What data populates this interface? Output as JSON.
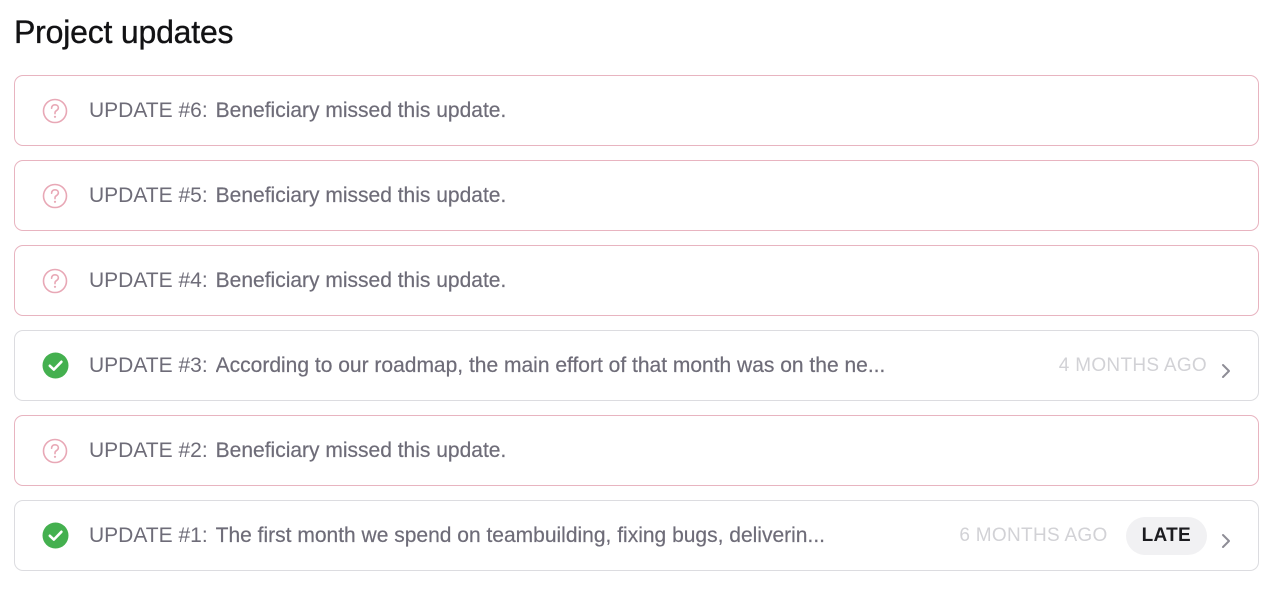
{
  "page": {
    "title": "Project updates"
  },
  "colors": {
    "missed_border": "#e8b4c0",
    "missed_icon": "#e8a8b6",
    "posted_border": "#dcdce0",
    "success_icon": "#44b04f",
    "muted_text": "#6e6c78",
    "timestamp": "#d2d2d6",
    "badge_bg": "#f1f1f3"
  },
  "updates": [
    {
      "number": "UPDATE #6:",
      "text": "Beneficiary missed this update.",
      "status": "missed",
      "icon": "question-circle-icon"
    },
    {
      "number": "UPDATE #5:",
      "text": "Beneficiary missed this update.",
      "status": "missed",
      "icon": "question-circle-icon"
    },
    {
      "number": "UPDATE #4:",
      "text": "Beneficiary missed this update.",
      "status": "missed",
      "icon": "question-circle-icon"
    },
    {
      "number": "UPDATE #3:",
      "text": "According to our roadmap, the main effort of that month was on the ne...",
      "status": "posted",
      "icon": "check-circle-icon",
      "time_ago": "4 MONTHS AGO"
    },
    {
      "number": "UPDATE #2:",
      "text": "Beneficiary missed this update.",
      "status": "missed",
      "icon": "question-circle-icon"
    },
    {
      "number": "UPDATE #1:",
      "text": "The first month we spend on teambuilding, fixing bugs, deliverin...",
      "status": "posted",
      "icon": "check-circle-icon",
      "time_ago": "6 MONTHS AGO",
      "badge": "LATE"
    }
  ]
}
